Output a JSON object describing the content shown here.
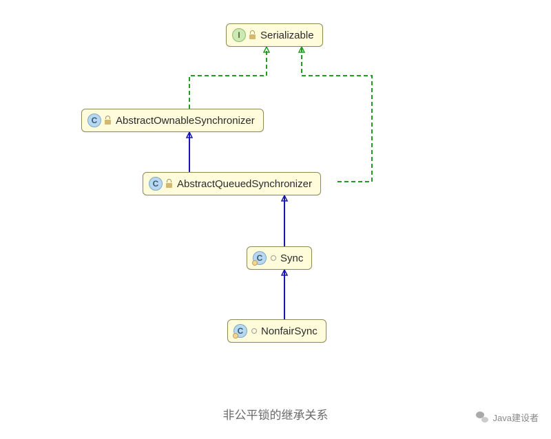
{
  "nodes": {
    "serializable": {
      "label": "Serializable",
      "type": "interface"
    },
    "aos": {
      "label": "AbstractOwnableSynchronizer",
      "type": "class"
    },
    "aqs": {
      "label": "AbstractQueuedSynchronizer",
      "type": "class"
    },
    "sync": {
      "label": "Sync",
      "type": "innerclass"
    },
    "nonfair": {
      "label": "NonfairSync",
      "type": "innerclass"
    }
  },
  "caption": "非公平锁的继承关系",
  "watermark": "Java建设者"
}
